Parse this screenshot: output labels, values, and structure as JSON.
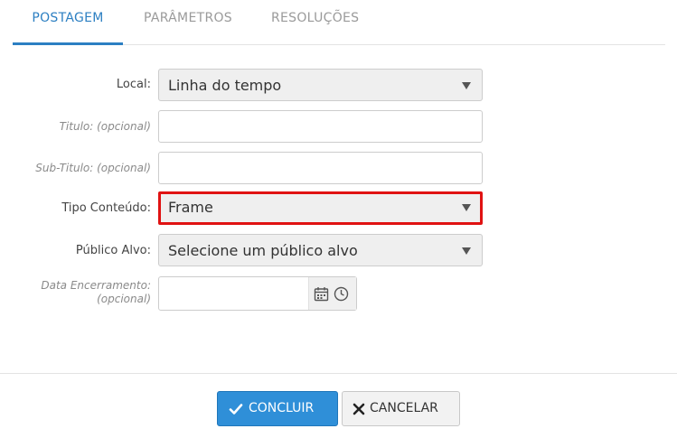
{
  "tabs": [
    {
      "label": "POSTAGEM",
      "active": true
    },
    {
      "label": "PARÂMETROS",
      "active": false
    },
    {
      "label": "RESOLUÇÕES",
      "active": false
    }
  ],
  "form": {
    "local": {
      "label": "Local:",
      "value": "Linha do tempo"
    },
    "titulo": {
      "label": "Titulo: (opcional)",
      "value": ""
    },
    "subtitulo": {
      "label": "Sub-Titulo: (opcional)",
      "value": ""
    },
    "tipo_conteudo": {
      "label": "Tipo Conteúdo:",
      "value": "Frame"
    },
    "publico_alvo": {
      "label": "Público Alvo:",
      "value": "Selecione um público alvo"
    },
    "data_encerramento": {
      "label_line1": "Data Encerramento:",
      "label_line2": "(opcional)",
      "value": ""
    }
  },
  "buttons": {
    "concluir": "CONCLUIR",
    "cancelar": "CANCELAR"
  },
  "colors": {
    "accent": "#2c7fc2",
    "primary_button": "#2f8fd8",
    "highlight_border": "#e01212"
  },
  "icons": {
    "select_arrow": "caret-down-icon",
    "date": "calendar-icon",
    "time": "clock-icon",
    "concluir": "check-icon",
    "cancelar": "x-icon"
  }
}
